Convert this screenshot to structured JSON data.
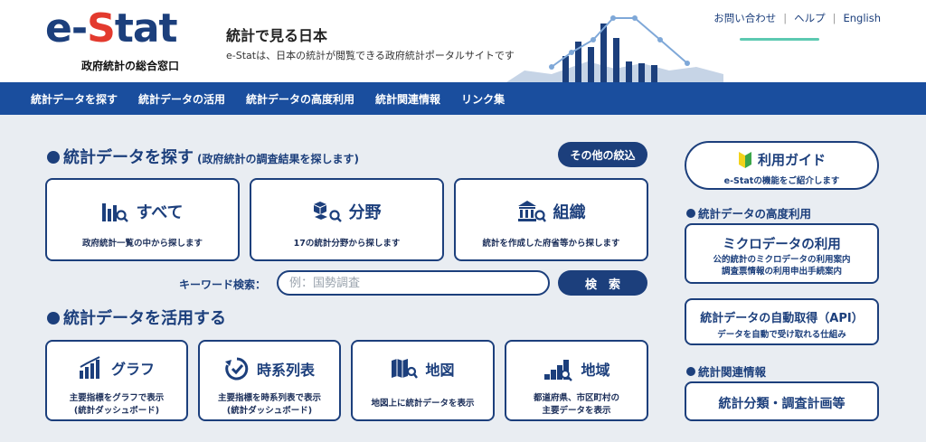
{
  "header": {
    "logo": {
      "word_e": "e-",
      "word_s": "S",
      "word_rest": "tat",
      "subtitle": "政府統計の総合窓口"
    },
    "site_title": "統計で見る日本",
    "site_desc": "e-Statは、日本の統計が閲覧できる政府統計ポータルサイトです",
    "links": [
      "お問い合わせ",
      "ヘルプ",
      "English"
    ],
    "separator": "|"
  },
  "nav": {
    "items": [
      "統計データを探す",
      "統計データの活用",
      "統計データの高度利用",
      "統計関連情報",
      "リンク集"
    ]
  },
  "find": {
    "heading": "統計データを探す",
    "subheading": "(政府統計の調査結果を探します)",
    "filter_button": "その他の絞込",
    "cards": [
      {
        "title": "すべて",
        "desc": "政府統計一覧の中から探します",
        "icon": "bar-chart-search-icon"
      },
      {
        "title": "分野",
        "desc": "17の統計分野から探します",
        "icon": "cubes-search-icon"
      },
      {
        "title": "組織",
        "desc": "統計を作成した府省等から探します",
        "icon": "building-search-icon"
      }
    ],
    "keyword_label": "キーワード検索：",
    "keyword_placeholder": "例：国勢調査",
    "search_button": "検　索"
  },
  "use": {
    "heading": "統計データを活用する",
    "cards": [
      {
        "title": "グラフ",
        "desc1": "主要指標をグラフで表示",
        "desc2": "(統計ダッシュボード)",
        "icon": "bar-graph-icon"
      },
      {
        "title": "時系列表",
        "desc1": "主要指標を時系列表で表示",
        "desc2": "(統計ダッシュボード)",
        "icon": "clock-arrow-icon"
      },
      {
        "title": "地図",
        "desc1": "地図上に統計データを表示",
        "desc2": "",
        "icon": "map-search-icon"
      },
      {
        "title": "地域",
        "desc1": "都道府県、市区町村の",
        "desc2": "主要データを表示",
        "icon": "region-stairs-icon"
      }
    ]
  },
  "right": {
    "guide": {
      "title": "利用ガイド",
      "desc": "e-Statの機能をご紹介します"
    },
    "advanced_heading": "統計データの高度利用",
    "micro": {
      "title": "ミクロデータの利用",
      "desc1": "公的統計のミクロデータの利用案内",
      "desc2": "調査票情報の利用申出手続案内"
    },
    "api": {
      "title": "統計データの自動取得（API）",
      "desc": "データを自動で受け取れる仕組み"
    },
    "related_heading": "統計関連情報",
    "classification": {
      "title": "統計分類・調査計画等"
    }
  },
  "colors": {
    "primary": "#1c3f7c",
    "nav": "#1a4e9e",
    "accent_red": "#e33a2e",
    "accent_green": "#5cc9b1",
    "background": "#e9edf2"
  }
}
